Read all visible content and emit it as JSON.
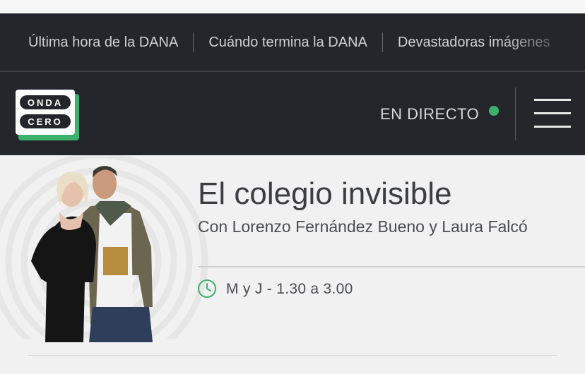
{
  "trending": {
    "items": [
      {
        "label": "Última hora de la DANA"
      },
      {
        "label": "Cuándo termina la DANA"
      },
      {
        "label": "Devastadoras imágenes"
      }
    ]
  },
  "header": {
    "logo": {
      "line1": "ONDA",
      "line2": "CERO"
    },
    "live_label": "EN DIRECTO",
    "colors": {
      "background": "#24262b",
      "live_dot": "#3bb36e",
      "logo_green": "#3bb36e"
    }
  },
  "program": {
    "title": "El colegio invisible",
    "hosts": "Con Lorenzo Fernández Bueno y Laura Falcó",
    "schedule": "M y J - 1.30 a 3.00",
    "accent": "#3bb36e",
    "image_icon": "hosts-photo"
  }
}
